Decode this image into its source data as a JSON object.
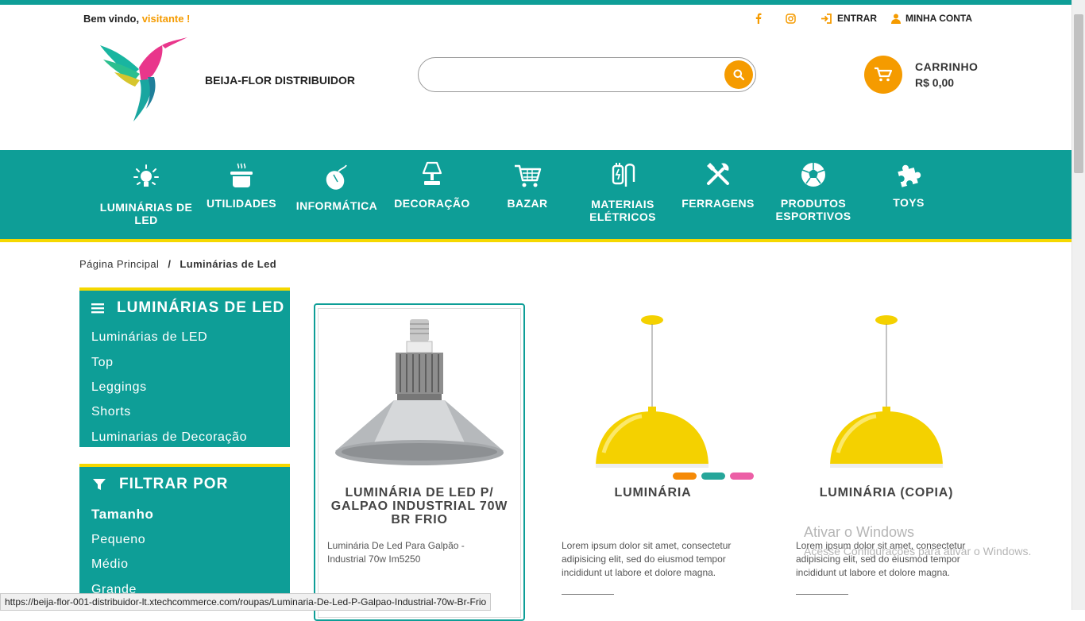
{
  "header": {
    "welcome_prefix": "Bem vindo,",
    "welcome_user": "visitante !",
    "login_label": "ENTRAR",
    "account_label": "MINHA CONTA",
    "brand_name": "BEIJA-FLOR DISTRIBUIDOR",
    "search_placeholder": "",
    "cart_title": "CARRINHO",
    "cart_total": "R$ 0,00"
  },
  "nav": {
    "items": [
      {
        "label": "LUMINÁRIAS DE LED",
        "icon": "lightbulb-icon"
      },
      {
        "label": "UTILIDADES",
        "icon": "cooking-pot-icon"
      },
      {
        "label": "INFORMÁTICA",
        "icon": "computer-mouse-icon"
      },
      {
        "label": "DECORAÇÃO",
        "icon": "table-lamp-icon"
      },
      {
        "label": "BAZAR",
        "icon": "shopping-cart-icon"
      },
      {
        "label": "MATERIAIS ELÉTRICOS",
        "icon": "electric-plug-icon"
      },
      {
        "label": "FERRAGENS",
        "icon": "tools-icon"
      },
      {
        "label": "PRODUTOS ESPORTIVOS",
        "icon": "soccer-ball-icon"
      },
      {
        "label": "TOYS",
        "icon": "puzzle-piece-icon"
      }
    ]
  },
  "breadcrumb": {
    "home": "Página Principal",
    "separator": "/",
    "current": "Luminárias de Led"
  },
  "category_panel": {
    "title": "LUMINÁRIAS DE LED",
    "items": [
      "Luminárias de LED",
      "Top",
      "Leggings",
      "Shorts",
      "Luminarias de Decoração"
    ]
  },
  "filter_panel": {
    "title": "FILTRAR POR",
    "group_title": "Tamanho",
    "options": [
      "Pequeno",
      "Médio",
      "Grande"
    ]
  },
  "products": [
    {
      "title": "LUMINÁRIA DE LED P/ GALPAO INDUSTRIAL 70W BR FRIO",
      "description": "Luminária De Led Para Galpão - Industrial 70w Im5250"
    },
    {
      "title": "LUMINÁRIA",
      "description": "Lorem ipsum dolor sit amet, consectetur adipisicing elit, sed do eiusmod tempor incididunt ut labore et dolore magna.",
      "color_options": [
        "#f58a07",
        "#26a69a",
        "#ec5fa6"
      ]
    },
    {
      "title": "LUMINÁRIA (COPIA)",
      "description": "Lorem ipsum dolor sit amet, consectetur adipisicing elit, sed do eiusmod tempor incididunt ut labore et dolore magna."
    }
  ],
  "watermark": {
    "title": "Ativar o Windows",
    "subtitle": "Acesse Configurações para ativar o Windows."
  },
  "status_bar": {
    "url": "https://beija-flor-001-distribuidor-lt.xtechcommerce.com/roupas/Luminaria-De-Led-P-Galpao-Industrial-70w-Br-Frio"
  },
  "colors": {
    "teal": "#0e9e97",
    "orange": "#f59b00",
    "yellow": "#f5d800"
  }
}
